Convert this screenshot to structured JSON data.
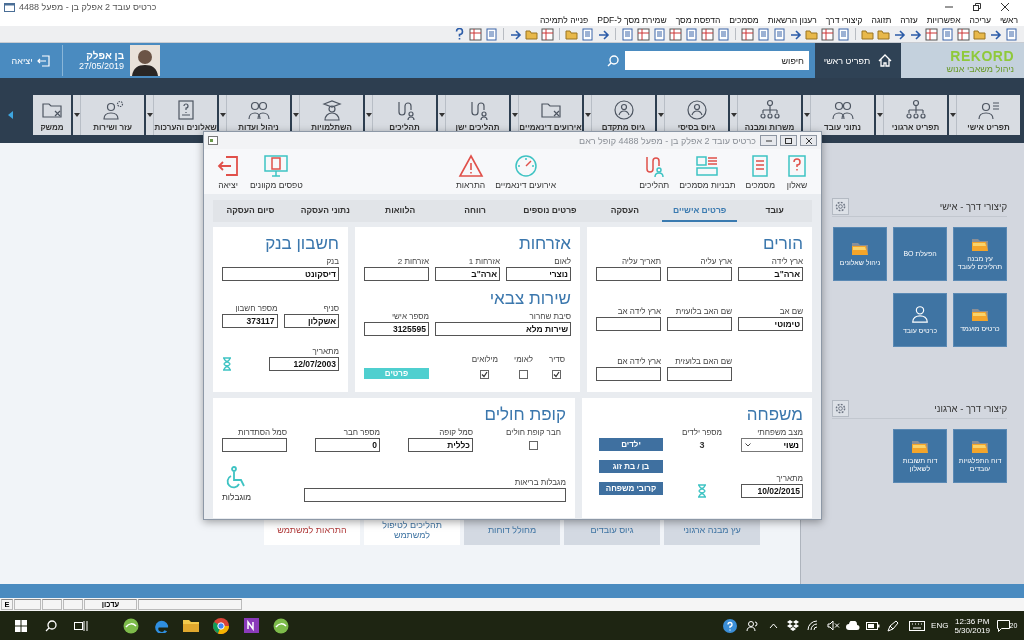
{
  "window": {
    "title": "כרטיס עובד 2 אפלק בן - מפעל 4488"
  },
  "menu": [
    "ראשי",
    "עריכה",
    "אפשרויות",
    "עזרה",
    "תזוגה",
    "קיצורי דרך",
    "רענון הרשאות",
    "מסמכים",
    "הדפסת מסך",
    "שמירת מסך ל-PDF",
    "פנייה לתמיכה"
  ],
  "header": {
    "logo": "REKORD",
    "logo_subtitle": "ניהול משאבי אנוש",
    "home": "תפריט ראשי",
    "search": {
      "placeholder": "חיפוש"
    },
    "user": {
      "name": "בן אפלק",
      "date": "27/05/2019"
    },
    "exit": "יציאה"
  },
  "ribbon": [
    "תפריט אישי",
    "תפריט ארגוני",
    "נתוני עובד",
    "משרות ומבנה",
    "גיוס בסיסי",
    "גיוס מתקדם",
    "אירועים דינאמיים",
    "תהליכים ישן",
    "תהליכים",
    "השתלמויות",
    "ניהול ועדות",
    "שאלונים והערכות",
    "עזר ושירות",
    "ממשק"
  ],
  "bottom_nav": [
    {
      "label": "עץ מבנה ארגוני",
      "kind": "nav"
    },
    {
      "label": "גיוס עובדים",
      "kind": "nav"
    },
    {
      "label": "מחולל דוחות",
      "kind": "nav"
    },
    {
      "label": "תהליכים לטיפול למשתמש",
      "kind": "task"
    },
    {
      "label": "התראות למשתמש",
      "kind": "alert"
    }
  ],
  "shortcuts": [
    {
      "title": "קיצורי דרך - אישי",
      "tiles": [
        {
          "label": "עץ מבנה תהליכים לעובד",
          "kind": "folder"
        },
        {
          "label": "הפעלת BO",
          "kind": "plain"
        },
        {
          "label": "ניהול שאלונים",
          "kind": "folder"
        },
        {
          "label": "כרטיס מועמד",
          "kind": "folder"
        },
        {
          "label": "כרטיס עובד",
          "kind": "person"
        }
      ]
    },
    {
      "title": "קיצורי דרך - ארגוני",
      "tiles": [
        {
          "label": "דוח התפלגויות עובדים",
          "kind": "folder"
        },
        {
          "label": "דוח תשובות לשאלון",
          "kind": "folder"
        }
      ]
    }
  ],
  "dialog": {
    "title": "כרטיס עובד 2 אפלק בן - מפעל 4488 קופל ראם",
    "tools": {
      "right": [
        "שאלון",
        "מסמכים",
        "תבניות מסמכים",
        "תהליכים"
      ],
      "center": [
        "אירועים דינאמיים",
        "התראות"
      ],
      "left": [
        "טפסים מקוונים",
        "יציאה"
      ]
    },
    "tabs": [
      {
        "label": "עובד",
        "selected": false
      },
      {
        "label": "פרטים אישיים",
        "selected": true
      },
      {
        "label": "העסקה",
        "selected": false
      },
      {
        "label": "פרטים נוספים",
        "selected": false
      },
      {
        "label": "רווחה",
        "selected": false
      },
      {
        "label": "הלוואות",
        "selected": false
      },
      {
        "label": "נתוני העסקה",
        "selected": false
      },
      {
        "label": "סיום העסקה",
        "selected": false
      }
    ],
    "parents": {
      "title": "הורים",
      "rows": [
        [
          {
            "kind": "field",
            "label": "ארץ לידה",
            "value": "ארה\"ב"
          },
          {
            "kind": "field",
            "label": "ארץ עליה"
          },
          {
            "kind": "field",
            "label": "תאריך עליה"
          }
        ],
        [
          {
            "kind": "field",
            "label": "שם אב",
            "value": "טימוטי"
          },
          {
            "kind": "field",
            "label": "שם האב בלועזית"
          },
          {
            "kind": "field",
            "label": "ארץ לידה אב"
          }
        ],
        [
          {
            "kind": "spacer"
          },
          {
            "kind": "field",
            "label": "שם האם בלועזית"
          },
          {
            "kind": "field",
            "label": "ארץ לידה אם"
          }
        ]
      ]
    },
    "citizenship": {
      "title": "אזרחות",
      "fields": [
        {
          "label": "לאום",
          "value": "נוצרי"
        },
        {
          "label": "אזרחות 1",
          "value": "ארה\"ב"
        },
        {
          "label": "אזרחות 2"
        }
      ]
    },
    "military": {
      "title": "שירות צבאי",
      "fields": [
        {
          "label": "סיבת שחרור",
          "value": "שירות מלא",
          "wide": true
        },
        {
          "label": "מספר אישי",
          "value": "3125595",
          "wide": false
        }
      ],
      "options": [
        {
          "label": "סדיר",
          "checked": true
        },
        {
          "label": "לאומי",
          "checked": false
        },
        {
          "label": "מילואים",
          "checked": true
        }
      ],
      "button": "פרטים"
    },
    "bank": {
      "title": "חשבון בנק",
      "bank": {
        "label": "בנק",
        "value": "דיסקונט"
      },
      "branch": {
        "label": "סניף",
        "value": "אשקלון"
      },
      "account": {
        "label": "מספר חשבון",
        "value": "373117"
      },
      "since": {
        "label": "מתאריך",
        "value": "12/07/2003"
      }
    },
    "family": {
      "title": "משפחה",
      "status": {
        "label": "מצב משפחתי",
        "value": "נשוי"
      },
      "children": {
        "label": "מספר ילדים",
        "value": "3"
      },
      "since": {
        "label": "מתאריך",
        "value": "10/02/2015"
      },
      "buttons": [
        "ילדים",
        "בן / בת זוג",
        "קרובי משפחה"
      ]
    },
    "health": {
      "title": "קופת חולים",
      "member": {
        "label": "חבר קופת חולים",
        "checked": false
      },
      "fields": [
        {
          "label": "סמל קופה",
          "value": "כללית"
        },
        {
          "label": "מספר חבר",
          "value": "0"
        },
        {
          "label": "סמל הסתדרות"
        }
      ],
      "limits": {
        "label": "מגבלות בריאות"
      },
      "disability": "מוגבלות"
    }
  },
  "status_bar": {
    "mode": "E",
    "update": "עדכון"
  },
  "taskbar": {
    "language": "ENG",
    "time": "12:36 PM",
    "date": "5/30/2019",
    "notifications": "20"
  }
}
